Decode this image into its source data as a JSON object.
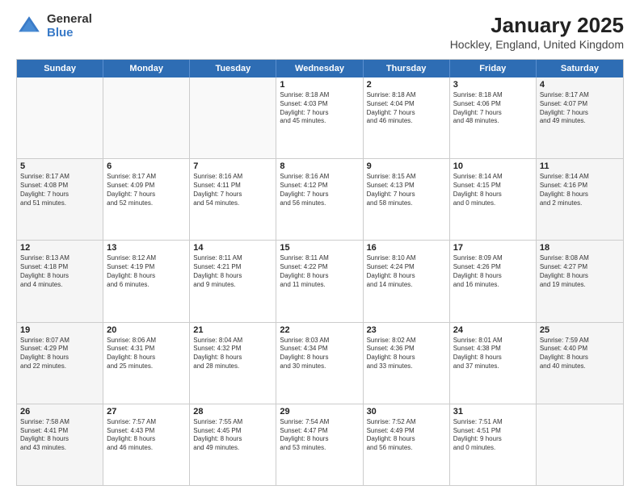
{
  "logo": {
    "line1": "General",
    "line2": "Blue"
  },
  "title": "January 2025",
  "subtitle": "Hockley, England, United Kingdom",
  "days": [
    "Sunday",
    "Monday",
    "Tuesday",
    "Wednesday",
    "Thursday",
    "Friday",
    "Saturday"
  ],
  "rows": [
    [
      {
        "day": "",
        "text": "",
        "empty": true
      },
      {
        "day": "",
        "text": "",
        "empty": true
      },
      {
        "day": "",
        "text": "",
        "empty": true
      },
      {
        "day": "1",
        "text": "Sunrise: 8:18 AM\nSunset: 4:03 PM\nDaylight: 7 hours\nand 45 minutes."
      },
      {
        "day": "2",
        "text": "Sunrise: 8:18 AM\nSunset: 4:04 PM\nDaylight: 7 hours\nand 46 minutes."
      },
      {
        "day": "3",
        "text": "Sunrise: 8:18 AM\nSunset: 4:06 PM\nDaylight: 7 hours\nand 48 minutes."
      },
      {
        "day": "4",
        "text": "Sunrise: 8:17 AM\nSunset: 4:07 PM\nDaylight: 7 hours\nand 49 minutes.",
        "shaded": true
      }
    ],
    [
      {
        "day": "5",
        "text": "Sunrise: 8:17 AM\nSunset: 4:08 PM\nDaylight: 7 hours\nand 51 minutes.",
        "shaded": true
      },
      {
        "day": "6",
        "text": "Sunrise: 8:17 AM\nSunset: 4:09 PM\nDaylight: 7 hours\nand 52 minutes."
      },
      {
        "day": "7",
        "text": "Sunrise: 8:16 AM\nSunset: 4:11 PM\nDaylight: 7 hours\nand 54 minutes."
      },
      {
        "day": "8",
        "text": "Sunrise: 8:16 AM\nSunset: 4:12 PM\nDaylight: 7 hours\nand 56 minutes."
      },
      {
        "day": "9",
        "text": "Sunrise: 8:15 AM\nSunset: 4:13 PM\nDaylight: 7 hours\nand 58 minutes."
      },
      {
        "day": "10",
        "text": "Sunrise: 8:14 AM\nSunset: 4:15 PM\nDaylight: 8 hours\nand 0 minutes."
      },
      {
        "day": "11",
        "text": "Sunrise: 8:14 AM\nSunset: 4:16 PM\nDaylight: 8 hours\nand 2 minutes.",
        "shaded": true
      }
    ],
    [
      {
        "day": "12",
        "text": "Sunrise: 8:13 AM\nSunset: 4:18 PM\nDaylight: 8 hours\nand 4 minutes.",
        "shaded": true
      },
      {
        "day": "13",
        "text": "Sunrise: 8:12 AM\nSunset: 4:19 PM\nDaylight: 8 hours\nand 6 minutes."
      },
      {
        "day": "14",
        "text": "Sunrise: 8:11 AM\nSunset: 4:21 PM\nDaylight: 8 hours\nand 9 minutes."
      },
      {
        "day": "15",
        "text": "Sunrise: 8:11 AM\nSunset: 4:22 PM\nDaylight: 8 hours\nand 11 minutes."
      },
      {
        "day": "16",
        "text": "Sunrise: 8:10 AM\nSunset: 4:24 PM\nDaylight: 8 hours\nand 14 minutes."
      },
      {
        "day": "17",
        "text": "Sunrise: 8:09 AM\nSunset: 4:26 PM\nDaylight: 8 hours\nand 16 minutes."
      },
      {
        "day": "18",
        "text": "Sunrise: 8:08 AM\nSunset: 4:27 PM\nDaylight: 8 hours\nand 19 minutes.",
        "shaded": true
      }
    ],
    [
      {
        "day": "19",
        "text": "Sunrise: 8:07 AM\nSunset: 4:29 PM\nDaylight: 8 hours\nand 22 minutes.",
        "shaded": true
      },
      {
        "day": "20",
        "text": "Sunrise: 8:06 AM\nSunset: 4:31 PM\nDaylight: 8 hours\nand 25 minutes."
      },
      {
        "day": "21",
        "text": "Sunrise: 8:04 AM\nSunset: 4:32 PM\nDaylight: 8 hours\nand 28 minutes."
      },
      {
        "day": "22",
        "text": "Sunrise: 8:03 AM\nSunset: 4:34 PM\nDaylight: 8 hours\nand 30 minutes."
      },
      {
        "day": "23",
        "text": "Sunrise: 8:02 AM\nSunset: 4:36 PM\nDaylight: 8 hours\nand 33 minutes."
      },
      {
        "day": "24",
        "text": "Sunrise: 8:01 AM\nSunset: 4:38 PM\nDaylight: 8 hours\nand 37 minutes."
      },
      {
        "day": "25",
        "text": "Sunrise: 7:59 AM\nSunset: 4:40 PM\nDaylight: 8 hours\nand 40 minutes.",
        "shaded": true
      }
    ],
    [
      {
        "day": "26",
        "text": "Sunrise: 7:58 AM\nSunset: 4:41 PM\nDaylight: 8 hours\nand 43 minutes.",
        "shaded": true
      },
      {
        "day": "27",
        "text": "Sunrise: 7:57 AM\nSunset: 4:43 PM\nDaylight: 8 hours\nand 46 minutes."
      },
      {
        "day": "28",
        "text": "Sunrise: 7:55 AM\nSunset: 4:45 PM\nDaylight: 8 hours\nand 49 minutes."
      },
      {
        "day": "29",
        "text": "Sunrise: 7:54 AM\nSunset: 4:47 PM\nDaylight: 8 hours\nand 53 minutes."
      },
      {
        "day": "30",
        "text": "Sunrise: 7:52 AM\nSunset: 4:49 PM\nDaylight: 8 hours\nand 56 minutes."
      },
      {
        "day": "31",
        "text": "Sunrise: 7:51 AM\nSunset: 4:51 PM\nDaylight: 9 hours\nand 0 minutes."
      },
      {
        "day": "",
        "text": "",
        "empty": true
      }
    ]
  ]
}
